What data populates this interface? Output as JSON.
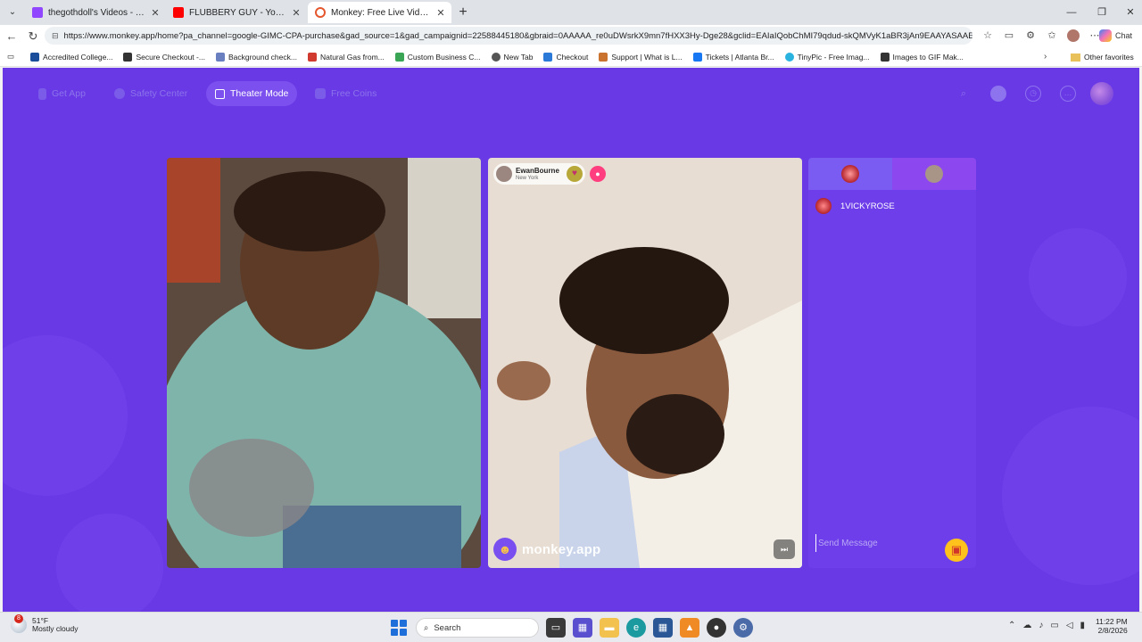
{
  "browser": {
    "tabs": [
      {
        "title": "thegothdoll's Videos - Twitch",
        "icon": "twitch-icon",
        "color": "#9146ff"
      },
      {
        "title": "FLUBBERY GUY - YouTube",
        "icon": "youtube-icon",
        "color": "#ff0000"
      },
      {
        "title": "Monkey: Free Live Video Chat",
        "icon": "monkey-icon",
        "color": "#e4572e"
      }
    ],
    "url": "https://www.monkey.app/home?pa_channel=google-GIMC-CPA-purchase&gad_source=1&gad_campaignid=22588445180&gbraid=0AAAAA_re0uDWsrkX9mn7fHXX3Hy-Dge28&gclid=EAIaIQobChMI79qdud-skQMVyK1aBR3jAn9EAAYASAAEgIh...",
    "chat_label": "Chat",
    "bookmarks": [
      {
        "label": "Accredited College...",
        "color": "#1a4e9a"
      },
      {
        "label": "Secure Checkout -...",
        "color": "#333333"
      },
      {
        "label": "Background check...",
        "color": "#6a7fbf"
      },
      {
        "label": "Natural Gas from...",
        "color": "#d13b2f"
      },
      {
        "label": "Custom Business C...",
        "color": "#3aa655"
      },
      {
        "label": "New Tab",
        "color": "#555555"
      },
      {
        "label": "Checkout",
        "color": "#2b7ad8"
      },
      {
        "label": "Support | What is L...",
        "color": "#c9732e"
      },
      {
        "label": "Tickets | Atlanta Br...",
        "color": "#1877f2"
      },
      {
        "label": "TinyPic - Free Imag...",
        "color": "#2bb3e0"
      },
      {
        "label": "Images to GIF Mak...",
        "color": "#333333"
      }
    ],
    "other_favorites": "Other favorites"
  },
  "page": {
    "nav": {
      "get_app": "Get App",
      "safety_center": "Safety Center",
      "theater_mode": "Theater Mode",
      "free_coins": "Free Coins"
    },
    "remote_user": {
      "name": "EwanBourne",
      "location": "New York"
    },
    "brand": "monkey.app",
    "chat": {
      "messages": [
        {
          "user": "1VICKYROSE"
        }
      ],
      "input_placeholder": "Send Message"
    },
    "colors": {
      "background": "#6a39e6",
      "accent": "#7b50ee",
      "gift": "#ffc21c"
    }
  },
  "taskbar": {
    "weather_temp": "51°F",
    "weather_desc": "Mostly cloudy",
    "weather_badge": "8",
    "search_label": "Search",
    "time": "11:22 PM",
    "date": "2/8/2026"
  }
}
